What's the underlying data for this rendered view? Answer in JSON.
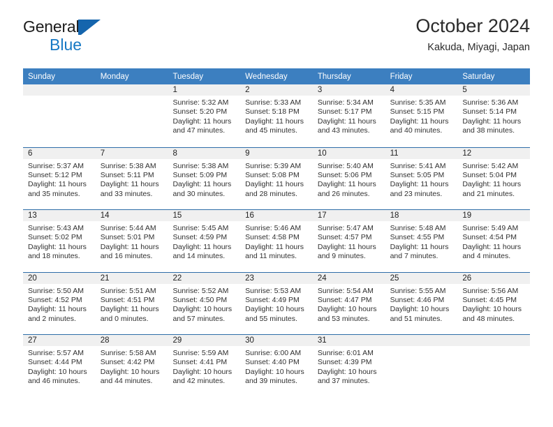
{
  "brand": {
    "line1": "General",
    "line2": "Blue",
    "mark_icon": "triangle-logo-icon",
    "accent_color": "#1779c4",
    "mark_color": "#1565ad"
  },
  "header": {
    "title": "October 2024",
    "subtitle": "Kakuda, Miyagi, Japan"
  },
  "theme": {
    "header_bg": "#3c7fc0",
    "header_text": "#ffffff",
    "row_divider": "#2e6da8",
    "day_band_bg": "#f0f0f0"
  },
  "weekdays": [
    "Sunday",
    "Monday",
    "Tuesday",
    "Wednesday",
    "Thursday",
    "Friday",
    "Saturday"
  ],
  "weeks": [
    [
      {
        "day": "",
        "empty": true
      },
      {
        "day": "",
        "empty": true
      },
      {
        "day": "1",
        "sunrise": "Sunrise: 5:32 AM",
        "sunset": "Sunset: 5:20 PM",
        "daylight1": "Daylight: 11 hours",
        "daylight2": "and 47 minutes."
      },
      {
        "day": "2",
        "sunrise": "Sunrise: 5:33 AM",
        "sunset": "Sunset: 5:18 PM",
        "daylight1": "Daylight: 11 hours",
        "daylight2": "and 45 minutes."
      },
      {
        "day": "3",
        "sunrise": "Sunrise: 5:34 AM",
        "sunset": "Sunset: 5:17 PM",
        "daylight1": "Daylight: 11 hours",
        "daylight2": "and 43 minutes."
      },
      {
        "day": "4",
        "sunrise": "Sunrise: 5:35 AM",
        "sunset": "Sunset: 5:15 PM",
        "daylight1": "Daylight: 11 hours",
        "daylight2": "and 40 minutes."
      },
      {
        "day": "5",
        "sunrise": "Sunrise: 5:36 AM",
        "sunset": "Sunset: 5:14 PM",
        "daylight1": "Daylight: 11 hours",
        "daylight2": "and 38 minutes."
      }
    ],
    [
      {
        "day": "6",
        "sunrise": "Sunrise: 5:37 AM",
        "sunset": "Sunset: 5:12 PM",
        "daylight1": "Daylight: 11 hours",
        "daylight2": "and 35 minutes."
      },
      {
        "day": "7",
        "sunrise": "Sunrise: 5:38 AM",
        "sunset": "Sunset: 5:11 PM",
        "daylight1": "Daylight: 11 hours",
        "daylight2": "and 33 minutes."
      },
      {
        "day": "8",
        "sunrise": "Sunrise: 5:38 AM",
        "sunset": "Sunset: 5:09 PM",
        "daylight1": "Daylight: 11 hours",
        "daylight2": "and 30 minutes."
      },
      {
        "day": "9",
        "sunrise": "Sunrise: 5:39 AM",
        "sunset": "Sunset: 5:08 PM",
        "daylight1": "Daylight: 11 hours",
        "daylight2": "and 28 minutes."
      },
      {
        "day": "10",
        "sunrise": "Sunrise: 5:40 AM",
        "sunset": "Sunset: 5:06 PM",
        "daylight1": "Daylight: 11 hours",
        "daylight2": "and 26 minutes."
      },
      {
        "day": "11",
        "sunrise": "Sunrise: 5:41 AM",
        "sunset": "Sunset: 5:05 PM",
        "daylight1": "Daylight: 11 hours",
        "daylight2": "and 23 minutes."
      },
      {
        "day": "12",
        "sunrise": "Sunrise: 5:42 AM",
        "sunset": "Sunset: 5:04 PM",
        "daylight1": "Daylight: 11 hours",
        "daylight2": "and 21 minutes."
      }
    ],
    [
      {
        "day": "13",
        "sunrise": "Sunrise: 5:43 AM",
        "sunset": "Sunset: 5:02 PM",
        "daylight1": "Daylight: 11 hours",
        "daylight2": "and 18 minutes."
      },
      {
        "day": "14",
        "sunrise": "Sunrise: 5:44 AM",
        "sunset": "Sunset: 5:01 PM",
        "daylight1": "Daylight: 11 hours",
        "daylight2": "and 16 minutes."
      },
      {
        "day": "15",
        "sunrise": "Sunrise: 5:45 AM",
        "sunset": "Sunset: 4:59 PM",
        "daylight1": "Daylight: 11 hours",
        "daylight2": "and 14 minutes."
      },
      {
        "day": "16",
        "sunrise": "Sunrise: 5:46 AM",
        "sunset": "Sunset: 4:58 PM",
        "daylight1": "Daylight: 11 hours",
        "daylight2": "and 11 minutes."
      },
      {
        "day": "17",
        "sunrise": "Sunrise: 5:47 AM",
        "sunset": "Sunset: 4:57 PM",
        "daylight1": "Daylight: 11 hours",
        "daylight2": "and 9 minutes."
      },
      {
        "day": "18",
        "sunrise": "Sunrise: 5:48 AM",
        "sunset": "Sunset: 4:55 PM",
        "daylight1": "Daylight: 11 hours",
        "daylight2": "and 7 minutes."
      },
      {
        "day": "19",
        "sunrise": "Sunrise: 5:49 AM",
        "sunset": "Sunset: 4:54 PM",
        "daylight1": "Daylight: 11 hours",
        "daylight2": "and 4 minutes."
      }
    ],
    [
      {
        "day": "20",
        "sunrise": "Sunrise: 5:50 AM",
        "sunset": "Sunset: 4:52 PM",
        "daylight1": "Daylight: 11 hours",
        "daylight2": "and 2 minutes."
      },
      {
        "day": "21",
        "sunrise": "Sunrise: 5:51 AM",
        "sunset": "Sunset: 4:51 PM",
        "daylight1": "Daylight: 11 hours",
        "daylight2": "and 0 minutes."
      },
      {
        "day": "22",
        "sunrise": "Sunrise: 5:52 AM",
        "sunset": "Sunset: 4:50 PM",
        "daylight1": "Daylight: 10 hours",
        "daylight2": "and 57 minutes."
      },
      {
        "day": "23",
        "sunrise": "Sunrise: 5:53 AM",
        "sunset": "Sunset: 4:49 PM",
        "daylight1": "Daylight: 10 hours",
        "daylight2": "and 55 minutes."
      },
      {
        "day": "24",
        "sunrise": "Sunrise: 5:54 AM",
        "sunset": "Sunset: 4:47 PM",
        "daylight1": "Daylight: 10 hours",
        "daylight2": "and 53 minutes."
      },
      {
        "day": "25",
        "sunrise": "Sunrise: 5:55 AM",
        "sunset": "Sunset: 4:46 PM",
        "daylight1": "Daylight: 10 hours",
        "daylight2": "and 51 minutes."
      },
      {
        "day": "26",
        "sunrise": "Sunrise: 5:56 AM",
        "sunset": "Sunset: 4:45 PM",
        "daylight1": "Daylight: 10 hours",
        "daylight2": "and 48 minutes."
      }
    ],
    [
      {
        "day": "27",
        "sunrise": "Sunrise: 5:57 AM",
        "sunset": "Sunset: 4:44 PM",
        "daylight1": "Daylight: 10 hours",
        "daylight2": "and 46 minutes."
      },
      {
        "day": "28",
        "sunrise": "Sunrise: 5:58 AM",
        "sunset": "Sunset: 4:42 PM",
        "daylight1": "Daylight: 10 hours",
        "daylight2": "and 44 minutes."
      },
      {
        "day": "29",
        "sunrise": "Sunrise: 5:59 AM",
        "sunset": "Sunset: 4:41 PM",
        "daylight1": "Daylight: 10 hours",
        "daylight2": "and 42 minutes."
      },
      {
        "day": "30",
        "sunrise": "Sunrise: 6:00 AM",
        "sunset": "Sunset: 4:40 PM",
        "daylight1": "Daylight: 10 hours",
        "daylight2": "and 39 minutes."
      },
      {
        "day": "31",
        "sunrise": "Sunrise: 6:01 AM",
        "sunset": "Sunset: 4:39 PM",
        "daylight1": "Daylight: 10 hours",
        "daylight2": "and 37 minutes."
      },
      {
        "day": "",
        "empty": true
      },
      {
        "day": "",
        "empty": true
      }
    ]
  ]
}
